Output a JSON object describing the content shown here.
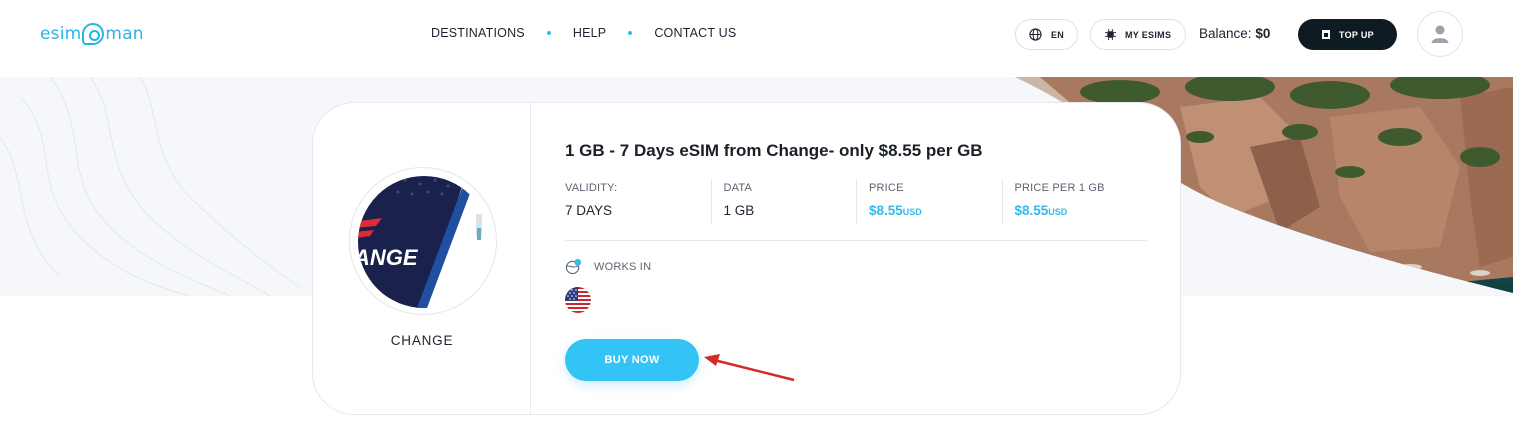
{
  "header": {
    "logo_text_left": "esim",
    "logo_text_right": "man",
    "nav": [
      "DESTINATIONS",
      "HELP",
      "CONTACT US"
    ],
    "language": "EN",
    "my_esims": "MY ESIMS",
    "balance_label": "Balance:",
    "balance_value": "$0",
    "topup": "TOP UP",
    "icons": {
      "language": "globe-icon",
      "esims": "sim-chip-icon",
      "topup": "sim-card-icon",
      "avatar": "user-icon"
    }
  },
  "plan": {
    "title": "1 GB - 7 Days eSIM from Change- only $8.55 per GB",
    "operator": "CHANGE",
    "operator_card_text": "ANGE",
    "specs": [
      {
        "label": "VALIDITY:",
        "value": "7 DAYS"
      },
      {
        "label": "DATA",
        "value": "1 GB"
      },
      {
        "label": "PRICE",
        "value": "$8.55",
        "currency": "USD"
      },
      {
        "label": "PRICE PER 1 GB",
        "value": "$8.55",
        "currency": "USD"
      }
    ],
    "works_in_label": "WORKS IN",
    "countries": [
      "us-flag-icon"
    ],
    "buy_button": "BUY NOW"
  },
  "colors": {
    "accent": "#35b9e9",
    "button": "#34c3f5",
    "dark": "#0f1b22"
  }
}
